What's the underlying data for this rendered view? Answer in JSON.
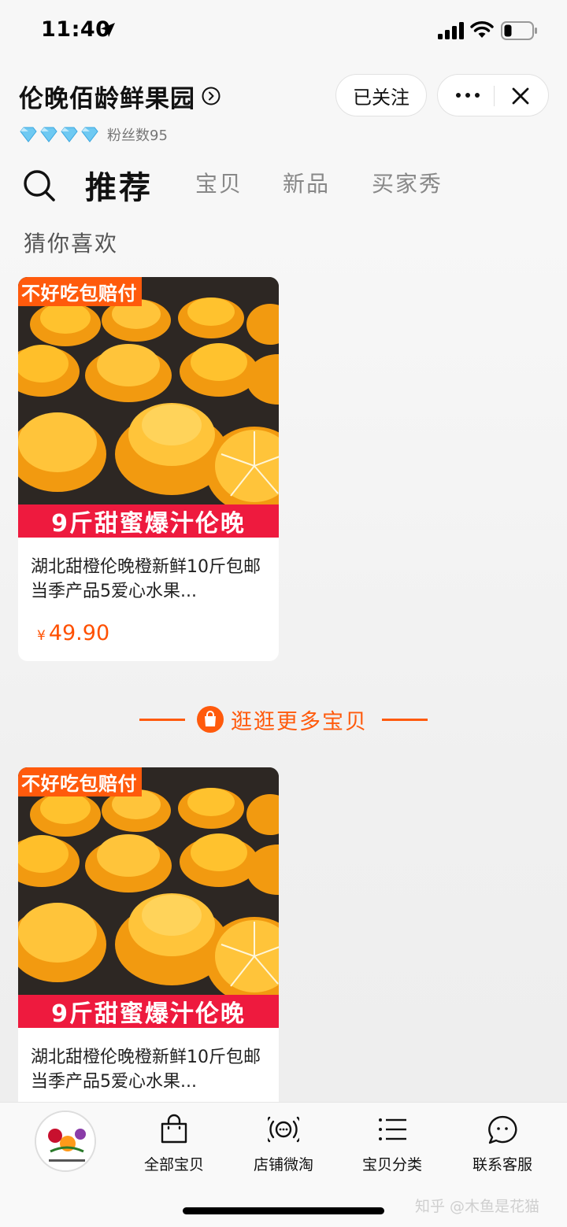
{
  "status_bar": {
    "time": "11:40"
  },
  "store": {
    "name": "伦晚佰龄鲜果园",
    "fans_label": "粉丝数95",
    "follow_label": "已关注"
  },
  "tabs": [
    {
      "label": "推荐",
      "active": true
    },
    {
      "label": "宝贝",
      "active": false
    },
    {
      "label": "新品",
      "active": false
    },
    {
      "label": "买家秀",
      "active": false
    }
  ],
  "section_title": "猜你喜欢",
  "products": [
    {
      "badge": "不好吃包赔付",
      "banner": "9斤甜蜜爆汁伦晚",
      "title": "湖北甜橙伦晚橙新鲜10斤包邮当季产品5爱心水果...",
      "currency": "¥",
      "price": "49.90"
    },
    {
      "badge": "不好吃包赔付",
      "banner": "9斤甜蜜爆汁伦晚",
      "title": "湖北甜橙伦晚橙新鲜10斤包邮当季产品5爱心水果..."
    }
  ],
  "more_label": "逛逛更多宝贝",
  "bottom_nav": [
    {
      "label": "全部宝贝",
      "icon": "shopping-bag-icon"
    },
    {
      "label": "店铺微淘",
      "icon": "broadcast-icon"
    },
    {
      "label": "宝贝分类",
      "icon": "list-icon"
    },
    {
      "label": "联系客服",
      "icon": "chat-bubble-icon"
    }
  ],
  "watermark": "知乎 @木鱼是花猫",
  "colors": {
    "accent": "#ff5a0c",
    "banner_red": "#ee1a3e",
    "price": "#ff5000"
  }
}
